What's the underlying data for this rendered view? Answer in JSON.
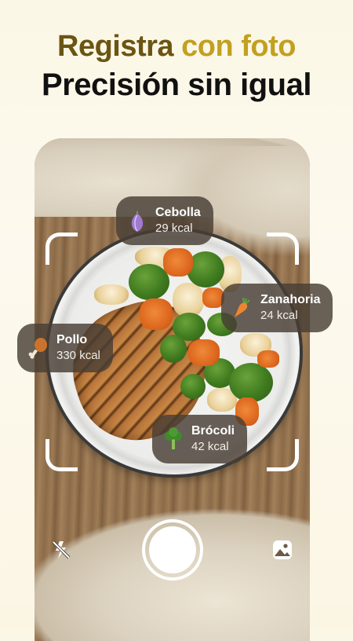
{
  "headline": {
    "line1_part1": "Registra",
    "line1_part2": "con foto",
    "line2": "Precisión sin igual"
  },
  "colors": {
    "headline_dark_gold": "#6b5512",
    "headline_gold": "#c2a020",
    "tag_background": "#483e34"
  },
  "camera": {
    "detections": [
      {
        "name": "Cebolla",
        "kcal": "29 kcal",
        "icon": "onion-icon"
      },
      {
        "name": "Zanahoria",
        "kcal": "24 kcal",
        "icon": "carrot-icon"
      },
      {
        "name": "Pollo",
        "kcal": "330 kcal",
        "icon": "chicken-leg-icon"
      },
      {
        "name": "Brócoli",
        "kcal": "42 kcal",
        "icon": "broccoli-icon"
      }
    ],
    "controls": {
      "flash": "flash-off-icon",
      "shutter": "shutter-button",
      "gallery": "gallery-icon"
    }
  }
}
